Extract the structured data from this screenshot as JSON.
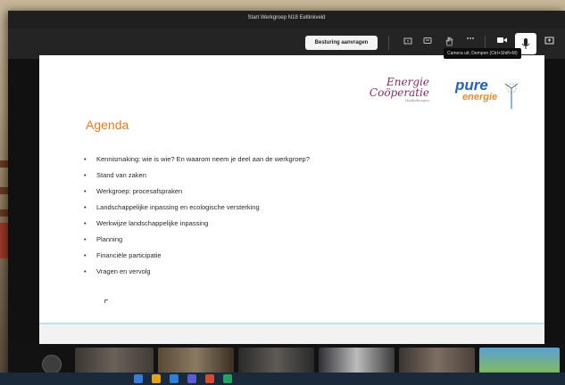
{
  "window": {
    "title": "Start Werkgroep N18 Eeltinkveld"
  },
  "toolbar": {
    "request_control_label": "Besturing aanvragen",
    "icons": [
      "share-tray-icon",
      "chat-icon",
      "raise-hand-icon",
      "more-options-icon",
      "camera-icon",
      "microphone-icon",
      "share-screen-icon"
    ]
  },
  "tooltip": {
    "text": "Camera uit;  Dempen (Ctrl+Shift+M)"
  },
  "slide": {
    "logo_left_line1": "Energie",
    "logo_left_line2": "Coöperatie",
    "logo_left_line3": "Haaksbergen",
    "logo_right_line1": "pure",
    "logo_right_line2": "energie",
    "heading": "Agenda",
    "items": [
      "Kennismaking: wie is wie? En waarom neem je deel aan de werkgroep?",
      "Stand van zaken",
      "Werkgroep: procesafspraken",
      "Landschappelijke inpassing en ecologische versterking",
      "Werkwijze landschappelijke inpassing",
      "Planning",
      "Financiële participatie",
      "Vragen en vervolg"
    ]
  },
  "colors": {
    "accent_orange": "#f07a14",
    "logo_purple": "#8c2a6d",
    "logo_blue": "#1f64c6",
    "toolbar_bg": "#242424"
  }
}
